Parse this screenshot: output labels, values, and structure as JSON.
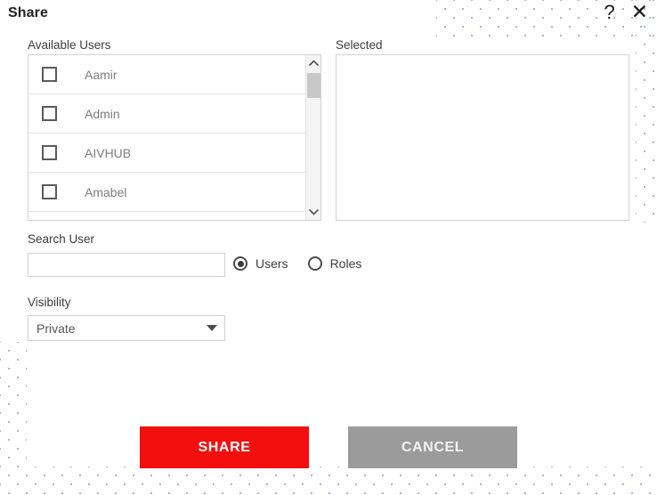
{
  "dialog": {
    "title": "Share",
    "help_icon": "question-mark-icon",
    "close_icon": "close-x-icon",
    "help_glyph": "?",
    "close_glyph": "✕"
  },
  "available": {
    "label": "Available Users",
    "users": [
      {
        "name": "Aamir",
        "checked": false
      },
      {
        "name": "Admin",
        "checked": false
      },
      {
        "name": "AIVHUB",
        "checked": false
      },
      {
        "name": "Amabel",
        "checked": false
      }
    ],
    "scrollbar": {
      "up_icon": "chevron-up-icon",
      "down_icon": "chevron-down-icon"
    }
  },
  "selected": {
    "label": "Selected",
    "items": []
  },
  "search": {
    "label": "Search User",
    "value": "",
    "placeholder": ""
  },
  "scope": {
    "options": [
      {
        "label": "Users",
        "selected": true
      },
      {
        "label": "Roles",
        "selected": false
      }
    ]
  },
  "visibility": {
    "label": "Visibility",
    "value": "Private",
    "caret_icon": "chevron-down-icon"
  },
  "footer": {
    "share_label": "SHARE",
    "cancel_label": "CANCEL"
  },
  "colors": {
    "share_button": "#f40f0f",
    "cancel_button": "#9b9b9b",
    "dot_pattern": "#aab3df"
  }
}
